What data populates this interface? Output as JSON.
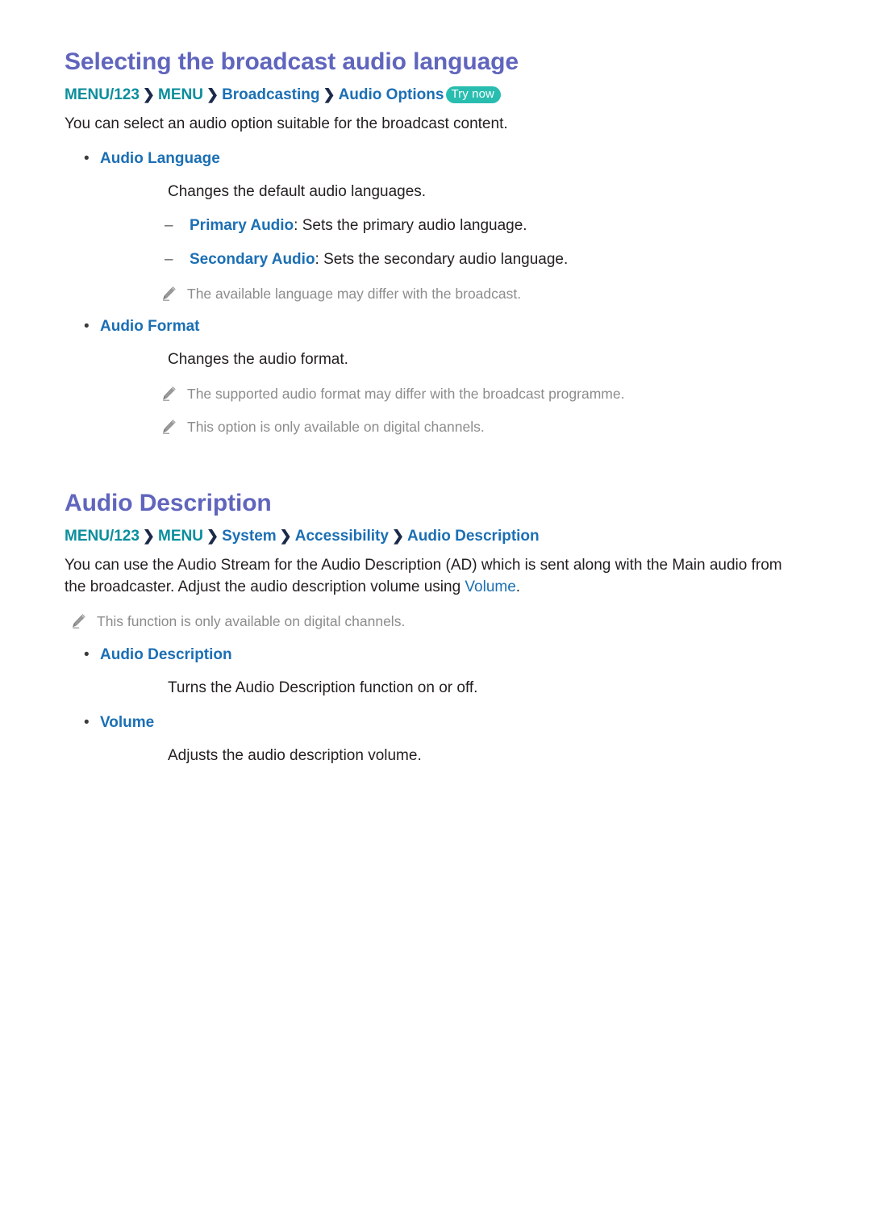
{
  "document": {
    "title": "Selecting the broadcast audio language"
  },
  "sections": [
    {
      "heading": "Selecting the broadcast audio language",
      "breadcrumb": {
        "items": [
          "MENU/123",
          "MENU",
          "Broadcasting",
          "Audio Options"
        ],
        "separator": "❯",
        "badge": "Try now"
      },
      "intro": "You can select an audio option suitable for the broadcast content.",
      "bullets": [
        {
          "label": "Audio Language",
          "desc": "Changes the default audio languages.",
          "subitems": [
            {
              "mark": "–",
              "key": "Primary Audio",
              "text": ": Sets the primary audio language."
            },
            {
              "mark": "–",
              "key": "Secondary Audio",
              "text": ": Sets the secondary audio language."
            }
          ],
          "notes": [
            "The available language may differ with the broadcast."
          ]
        },
        {
          "label": "Audio Format",
          "desc": "Changes the audio format.",
          "subitems": [],
          "notes": [
            "The supported audio format may differ with the broadcast programme.",
            "This option is only available on digital channels."
          ]
        }
      ]
    },
    {
      "heading": "Audio Description",
      "breadcrumb": {
        "items": [
          "MENU/123",
          "MENU",
          "System",
          "Accessibility",
          "Audio Description"
        ],
        "separator": "❯",
        "badge": ""
      },
      "intro_parts": {
        "before": "You can use the Audio Stream for the Audio Description (AD) which is sent along with the Main audio from the broadcaster. Adjust the audio description volume using ",
        "link": "Volume",
        "after": "."
      },
      "notes": [
        "This function is only available on digital channels."
      ],
      "bullets": [
        {
          "label": "Audio Description",
          "desc": "Turns the Audio Description function on or off.",
          "subitems": [],
          "notes": []
        },
        {
          "label": "Volume",
          "desc": "Adjusts the audio description volume.",
          "subitems": [],
          "notes": []
        }
      ]
    }
  ],
  "markers": {
    "bullet": "•",
    "dash": "–"
  },
  "colors": {
    "heading": "#6065bd",
    "crumb_teal": "#0b8e9c",
    "crumb_blue": "#1b6fb4",
    "badge_bg": "#29bdb0",
    "body": "#231f20",
    "note": "#8c8c8c"
  },
  "icons": {
    "note": "pencil-icon"
  }
}
